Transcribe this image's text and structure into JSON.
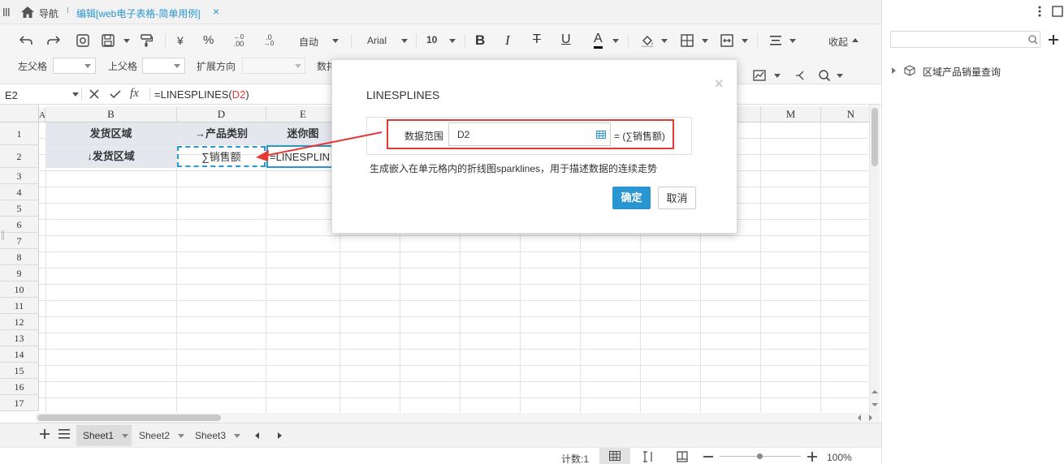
{
  "topbar": {
    "nav_label": "导航",
    "separator": "I",
    "edit_tab": "编辑[web电子表格-简单用例]",
    "close_glyph": "×"
  },
  "toolbar": {
    "currency": "¥",
    "percent": "%",
    "dec_inc": ".00",
    "dec_dec": ".0",
    "format_value": "自动",
    "font_name": "Arial",
    "font_size": "10",
    "bold": "B",
    "italic": "I",
    "strike": "T",
    "underline": "U",
    "font_color_glyph": "A",
    "collapse": "收起",
    "left_parent_label": "左父格",
    "top_parent_label": "上父格",
    "expand_dir_label": "扩展方向",
    "data_label_partial": "数排"
  },
  "formula_bar": {
    "cell_ref": "E2",
    "fx": "fx",
    "formula_prefix": "=LINESPLINES(",
    "formula_arg": "D2",
    "formula_suffix": ")"
  },
  "grid": {
    "columns": [
      "A",
      "B",
      "D",
      "E",
      "M",
      "N"
    ],
    "rows": [
      "1",
      "2",
      "3",
      "4",
      "5",
      "6",
      "7",
      "8",
      "9",
      "10",
      "11",
      "12",
      "13",
      "14",
      "15",
      "16",
      "17"
    ],
    "cells": {
      "b1": "发货区域",
      "d1": "→产品类别",
      "e1": "迷你图",
      "b2": "↓发货区域",
      "d2": "∑销售额",
      "e2": "=LINESPLIN"
    }
  },
  "sheet_tabs": [
    "Sheet1",
    "Sheet2",
    "Sheet3"
  ],
  "status": {
    "count_label": "计数:1",
    "zoom": "100%"
  },
  "right_panel": {
    "search_placeholder": "",
    "tree_item": "区域产品销量查询"
  },
  "dialog": {
    "title": "LINESPLINES",
    "close_glyph": "×",
    "field_label": "数据范围",
    "field_value": "D2",
    "result_text": "= (∑销售额)",
    "description": "生成嵌入在单元格内的折线图sparklines，用于描述数据的连续走势",
    "confirm_label": "确定",
    "cancel_label": "取消"
  },
  "colors": {
    "accent": "#2a96d1",
    "header_fill": "#e4e8ee",
    "highlight_red": "#e53935",
    "formula_ref": "#e53935"
  }
}
